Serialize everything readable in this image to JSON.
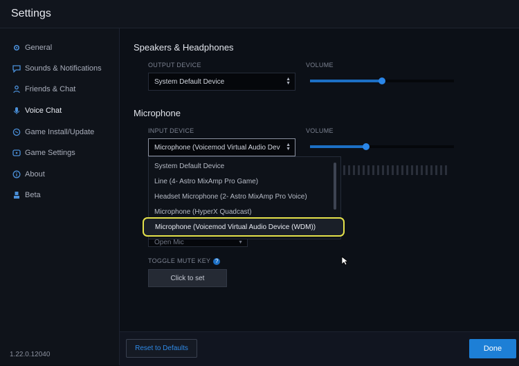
{
  "window": {
    "title": "Settings"
  },
  "sidebar": {
    "items": [
      {
        "label": "General",
        "icon": "gear-icon"
      },
      {
        "label": "Sounds & Notifications",
        "icon": "speech-bubble-icon"
      },
      {
        "label": "Friends & Chat",
        "icon": "person-icon"
      },
      {
        "label": "Voice Chat",
        "icon": "microphone-icon",
        "active": true
      },
      {
        "label": "Game Install/Update",
        "icon": "globe-icon"
      },
      {
        "label": "Game Settings",
        "icon": "gamepad-icon"
      },
      {
        "label": "About",
        "icon": "info-icon"
      },
      {
        "label": "Beta",
        "icon": "user-icon"
      }
    ],
    "version": "1.22.0.12040"
  },
  "speakers": {
    "title": "Speakers & Headphones",
    "output_label": "OUTPUT DEVICE",
    "output_value": "System Default Device",
    "volume_label": "VOLUME",
    "volume_level": 0.5
  },
  "microphone": {
    "title": "Microphone",
    "input_label": "INPUT DEVICE",
    "input_value": "Microphone (Voicemod Virtual Audio Dev",
    "volume_label": "VOLUME",
    "volume_level": 0.39,
    "options": [
      "System Default Device",
      "Line (4- Astro MixAmp Pro Game)",
      "Headset Microphone (2- Astro MixAmp Pro Voice)",
      "Microphone (HyperX Quadcast)",
      "Microphone (Voicemod Virtual Audio Device (WDM))"
    ],
    "highlighted_option": "Microphone (Voicemod Virtual Audio Device (WDM))",
    "mode_value": "Open Mic",
    "toggle_mute_label": "TOGGLE MUTE KEY",
    "toggle_mute_button": "Click to set"
  },
  "footer": {
    "reset_label": "Reset to Defaults",
    "done_label": "Done"
  },
  "colors": {
    "accent": "#1d7fd6",
    "highlight": "#e5e24a",
    "background": "#0b0e14"
  }
}
